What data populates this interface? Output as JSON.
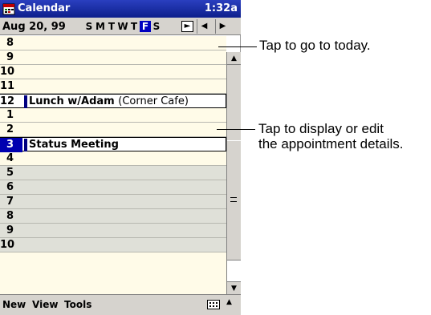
{
  "titlebar": {
    "app_name": "Calendar",
    "clock": "1:32a",
    "icon": "calendar-app-icon"
  },
  "datebar": {
    "date": "Aug 20, 99",
    "days": [
      "S",
      "M",
      "T",
      "W",
      "T",
      "F",
      "S"
    ],
    "selected_day_index": 5,
    "today_icon": "go-to-today-icon",
    "prev_icon": "left-arrow-icon",
    "next_icon": "right-arrow-icon"
  },
  "schedule": [
    {
      "hour": "8"
    },
    {
      "hour": "9"
    },
    {
      "hour": "10"
    },
    {
      "hour": "11"
    },
    {
      "hour": "12",
      "title": "Lunch w/Adam",
      "location": "(Corner Cafe)"
    },
    {
      "hour": "1"
    },
    {
      "hour": "2"
    },
    {
      "hour": "3",
      "title": "Status Meeting",
      "location": ""
    },
    {
      "hour": "4"
    },
    {
      "hour": "5"
    },
    {
      "hour": "6"
    },
    {
      "hour": "7"
    },
    {
      "hour": "8"
    },
    {
      "hour": "9"
    },
    {
      "hour": "10"
    }
  ],
  "menubar": {
    "items": [
      "New",
      "View",
      "Tools"
    ],
    "keyboard_icon": "keyboard-icon"
  },
  "callouts": {
    "today": "Tap to go to today.",
    "appt_line1": "Tap to display or edit",
    "appt_line2": "the appointment details."
  }
}
